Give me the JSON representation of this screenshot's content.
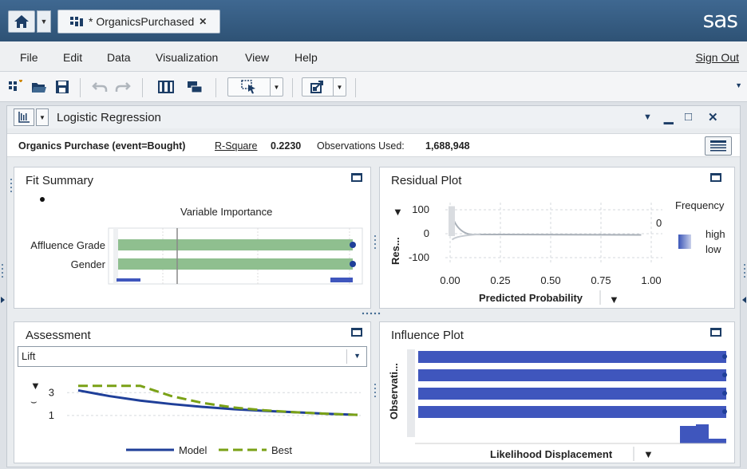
{
  "header": {
    "tab_label": "* OrganicsPurchased",
    "logo_text": "sas"
  },
  "menu": {
    "items": [
      "File",
      "Edit",
      "Data",
      "Visualization",
      "View",
      "Help"
    ],
    "signout": "Sign Out"
  },
  "object": {
    "title": "Logistic Regression"
  },
  "info": {
    "response": "Organics Purchase (event=Bought)",
    "rsq_label": "R-Square",
    "rsq_value": "0.2230",
    "obs_label": "Observations Used:",
    "obs_value": "1,688,948"
  },
  "fit_summary": {
    "title": "Fit Summary",
    "chart_title": "Variable Importance",
    "variables": [
      "Affluence Grade",
      "Gender"
    ]
  },
  "residual": {
    "title": "Residual Plot",
    "legend_title": "Frequency",
    "legend_high": "high",
    "legend_low": "low",
    "ylabel": "Res...",
    "xlabel": "Predicted Probability",
    "zero_label": "0",
    "colors": {
      "axis": "#222222",
      "points": "#a9b0b8",
      "legend_high": "#3b56b8",
      "legend_low": "#ffffff"
    }
  },
  "assessment": {
    "title": "Assessment",
    "select_value": "Lift",
    "legend_model": "Model",
    "legend_best": "Best",
    "colors": {
      "model": "#1f3f99",
      "best": "#7aa116"
    }
  },
  "influence": {
    "title": "Influence Plot",
    "ylabel": "Observati...",
    "xlabel": "Likelihood Displacement",
    "colors": {
      "bar": "#3f56bd"
    }
  },
  "chart_data": [
    {
      "type": "line",
      "x": [
        0.0,
        0.25,
        0.5,
        0.75,
        1.0
      ],
      "xticks": [
        "0.00",
        "0.25",
        "0.50",
        "0.75",
        "1.00"
      ],
      "yticks": [
        "100",
        "0",
        "-100"
      ],
      "xlabel": "Predicted Probability",
      "ylabel": "Res...",
      "xlim": [
        0,
        1
      ],
      "ylim": [
        -130,
        130
      ],
      "grid": true,
      "legend": "right"
    },
    {
      "type": "line",
      "x": [
        1,
        2,
        3,
        4,
        5,
        6,
        7,
        8,
        9,
        10
      ],
      "series": [
        {
          "name": "Model",
          "values": [
            3.2,
            2.7,
            2.3,
            2.0,
            1.75,
            1.55,
            1.4,
            1.28,
            1.15,
            1.05
          ]
        },
        {
          "name": "Best",
          "values": [
            3.6,
            3.6,
            3.6,
            2.7,
            2.1,
            1.7,
            1.45,
            1.28,
            1.15,
            1.05
          ]
        }
      ],
      "yticks": [
        "3",
        "1"
      ],
      "ylim": [
        0.5,
        4
      ],
      "grid": true,
      "legend": "bottom"
    }
  ]
}
